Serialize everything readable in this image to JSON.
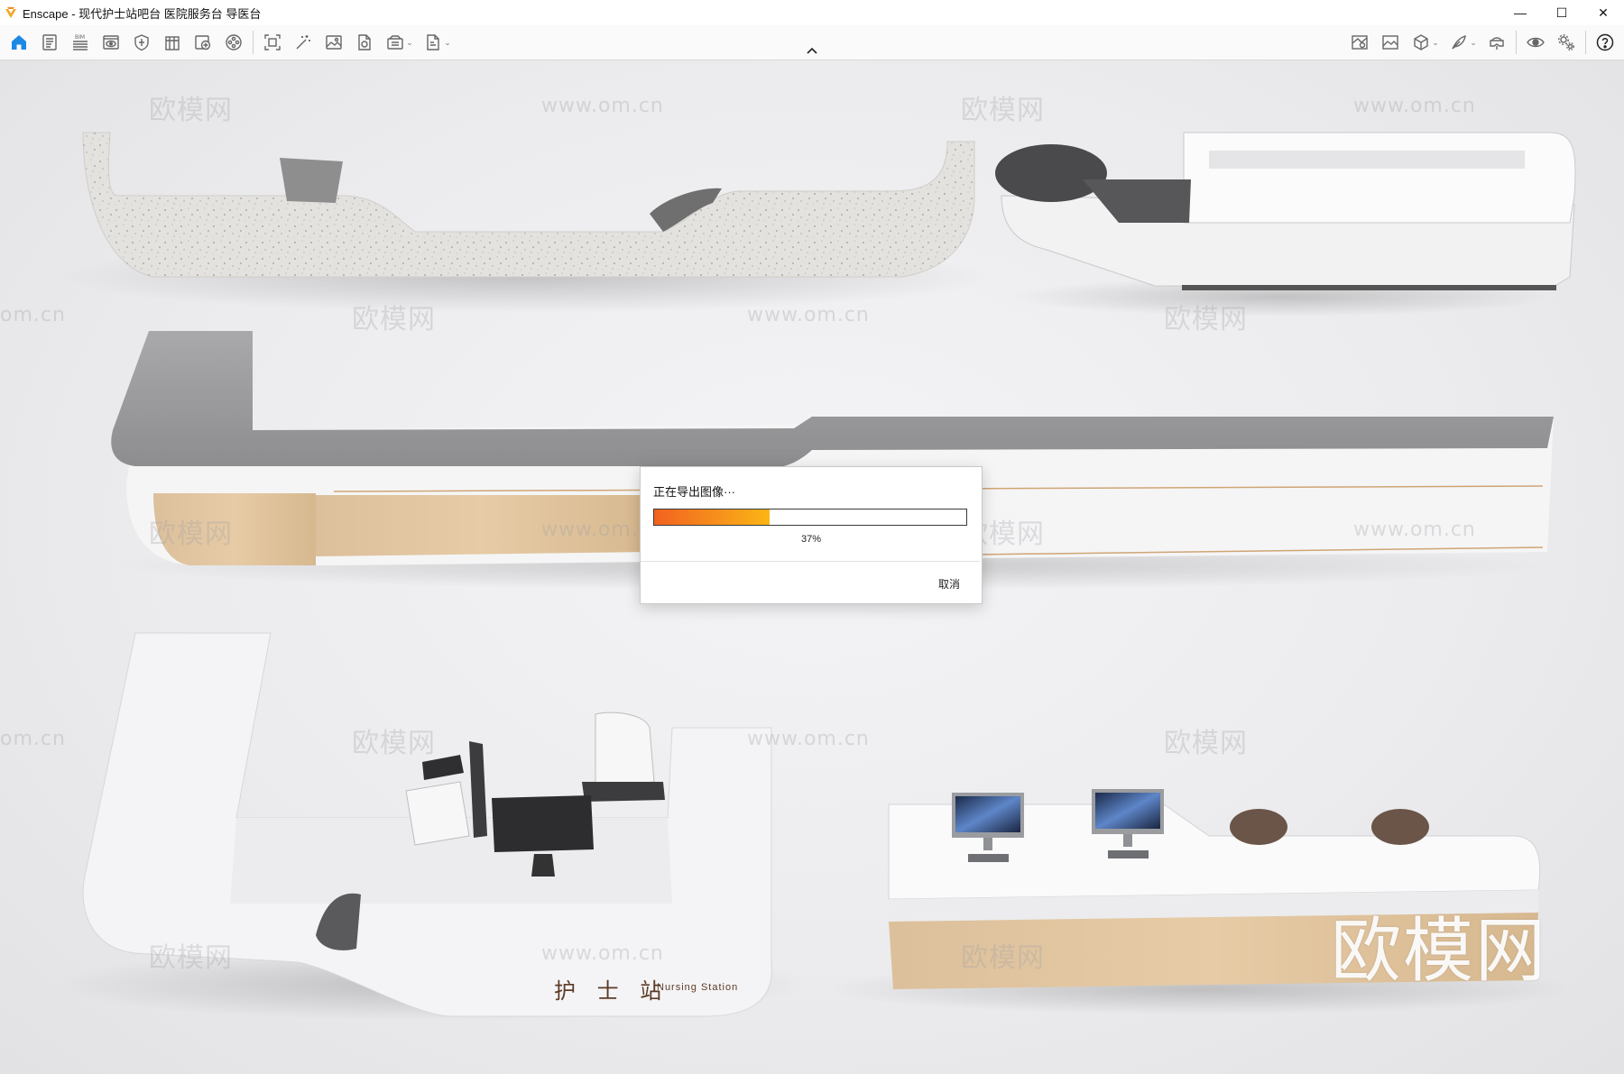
{
  "window": {
    "title": "Enscape - 现代护士站吧台 医院服务台 导医台",
    "minimize_glyph": "—",
    "maximize_glyph": "☐",
    "close_glyph": "✕",
    "logo_color": "#f5a623"
  },
  "toolbar": {
    "left_icons": [
      "home-icon",
      "document-icon",
      "bim-icon",
      "view-icon",
      "shield-icon",
      "building-icon",
      "panorama-icon",
      "film-reel-icon",
      "screenshot-icon",
      "magic-wand-icon",
      "image-icon",
      "file-export-icon",
      "batch-render-icon",
      "export-dropdown-icon"
    ],
    "right_icons": [
      "map-icon",
      "gallery-icon",
      "cube-icon",
      "feather-icon",
      "vr-headset-icon",
      "eye-icon",
      "settings-icon",
      "help-icon"
    ],
    "accent_color": "#1e88e5"
  },
  "scene": {
    "watermark_cn": "欧模网",
    "watermark_url": "www.om.cn",
    "watermark_partial_url": "om.cn",
    "brand_large": "欧模网",
    "sign_cn": "护 士 站",
    "sign_en": "Nursing Station"
  },
  "dialog": {
    "title": "正在导出图像···",
    "progress_percent": 37,
    "progress_text": "37%",
    "cancel_label": "取消"
  }
}
